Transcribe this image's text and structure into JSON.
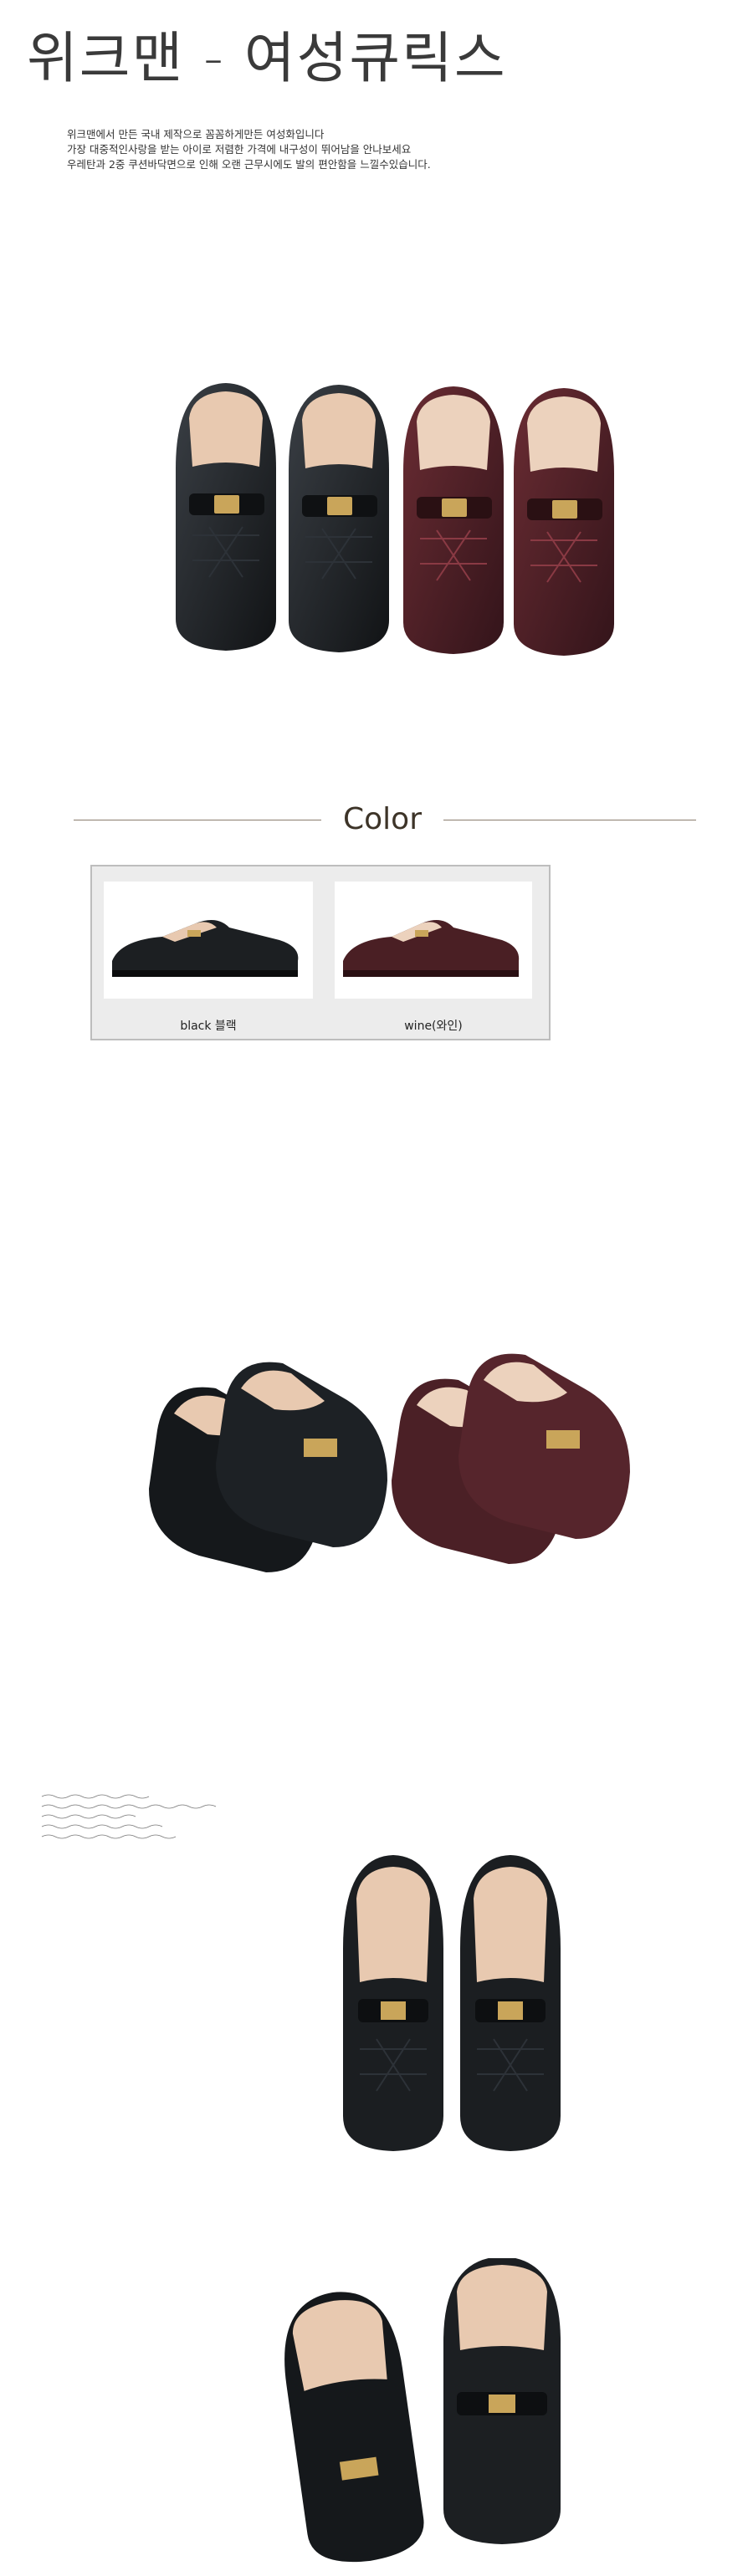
{
  "page": {
    "title": "위크맨 - 여성큐릭스",
    "intro_lines": [
      "위크맨에서 만든 국내 제작으로 꼼꼼하게만든 여성화입니다",
      "가장 대중적인사랑을 받는 아이로 저렴한 가격에 내구성이 뛰어남을 안나보세요",
      "우레탄과 2중 쿠션바닥면으로 인해 오랜 근무시에도 발의 편안함을 느낄수있습니다."
    ]
  },
  "colors": {
    "heading": "Color",
    "options": [
      {
        "label": "black 블랙",
        "swatch": "#1c1f22"
      },
      {
        "label": "wine(와인)",
        "swatch": "#4a1f24"
      }
    ]
  },
  "palette": {
    "black_shoe": "#1b1e21",
    "wine_shoe": "#4b2026",
    "insole": "#e8c9b0",
    "buckle": "#c9a55a"
  },
  "images": [
    {
      "name": "hero-pair-photo",
      "icon": "shoe-icon"
    },
    {
      "name": "angled-pairs-photo",
      "icon": "shoe-icon"
    },
    {
      "name": "black-pair-top-photo",
      "icon": "shoe-icon"
    },
    {
      "name": "black-pair-angled-photo",
      "icon": "shoe-icon"
    }
  ]
}
